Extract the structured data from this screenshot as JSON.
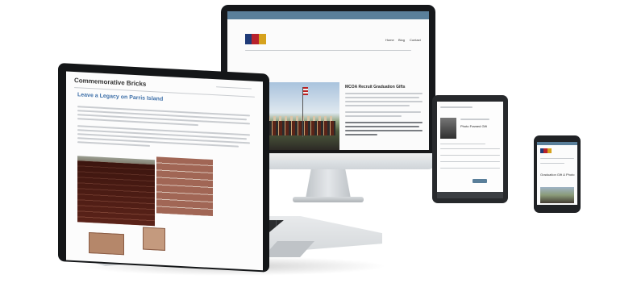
{
  "devices": {
    "desktop": {
      "nav": [
        "Home",
        "Blog",
        "Contact"
      ],
      "hero_title": "MCOA Recruit Graduation Gifts"
    },
    "laptop": {
      "page_heading": "Commemorative Bricks",
      "section_title": "Leave a Legacy on Parris Island"
    },
    "tablet": {
      "product_title": "Photo Framed Gift"
    },
    "phone": {
      "product_title": "Graduation Gift & Photo"
    }
  },
  "colors": {
    "header_blue": "#5a7f9a",
    "link_blue": "#3d6fa8",
    "logo_navy": "#1f3b78",
    "logo_red": "#b8222c",
    "logo_gold": "#d6a21d"
  }
}
